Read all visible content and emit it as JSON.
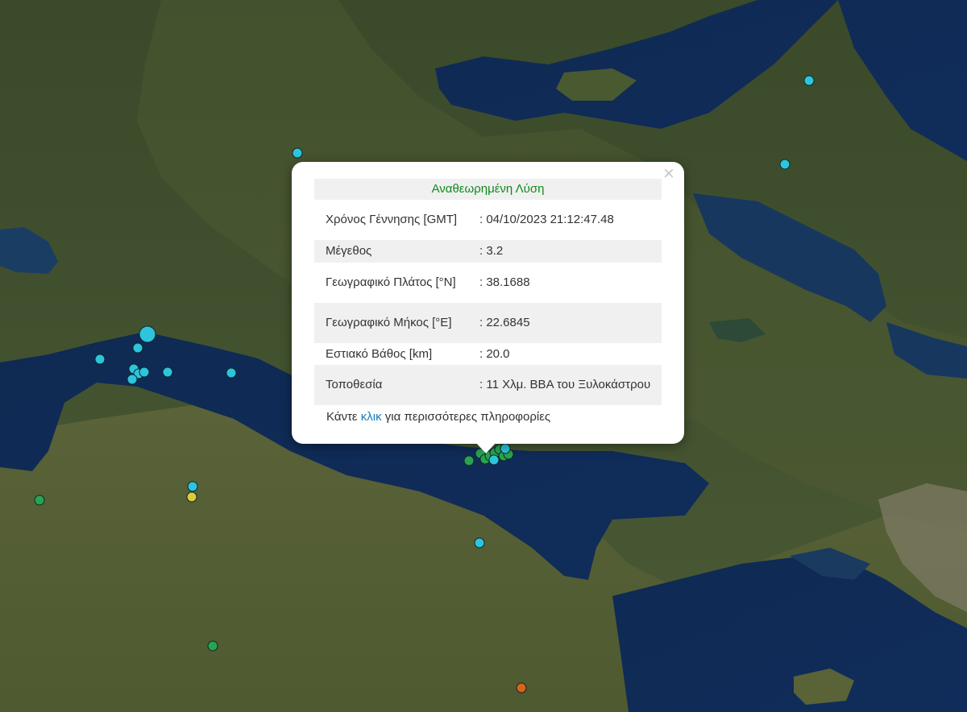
{
  "popup": {
    "title": "Αναθεωρημένη Λύση",
    "close_symbol": "×",
    "rows": [
      {
        "label": "Χρόνος Γέννησης [GMT]",
        "value": ": 04/10/2023 21:12:47.48"
      },
      {
        "label": "Μέγεθος",
        "value": ": 3.2"
      },
      {
        "label": "Γεωγραφικό Πλάτος [°N]",
        "value": ": 38.1688"
      },
      {
        "label": "Γεωγραφικό Μήκος [°E]",
        "value": ": 22.6845"
      },
      {
        "label": "Εστιακό Βάθος [km]",
        "value": ": 20.0"
      },
      {
        "label": "Τοποθεσία",
        "value": ": 11 Χλμ. ΒΒΑ του Ξυλοκάστρου"
      }
    ],
    "footer_prefix": "Κάντε ",
    "footer_link": "κλικ",
    "footer_suffix": " για περισσότερες πληροφορίες"
  },
  "colors": {
    "popup_title": "#0f8a1a",
    "link": "#1a7bbd",
    "marker_cyan": "#2ec4dc",
    "marker_green": "#2aa350",
    "marker_yellow": "#e0c93a",
    "marker_orange": "#d9621a"
  },
  "map": {
    "type": "satellite",
    "marker_icon": "earthquake-circle-marker"
  }
}
